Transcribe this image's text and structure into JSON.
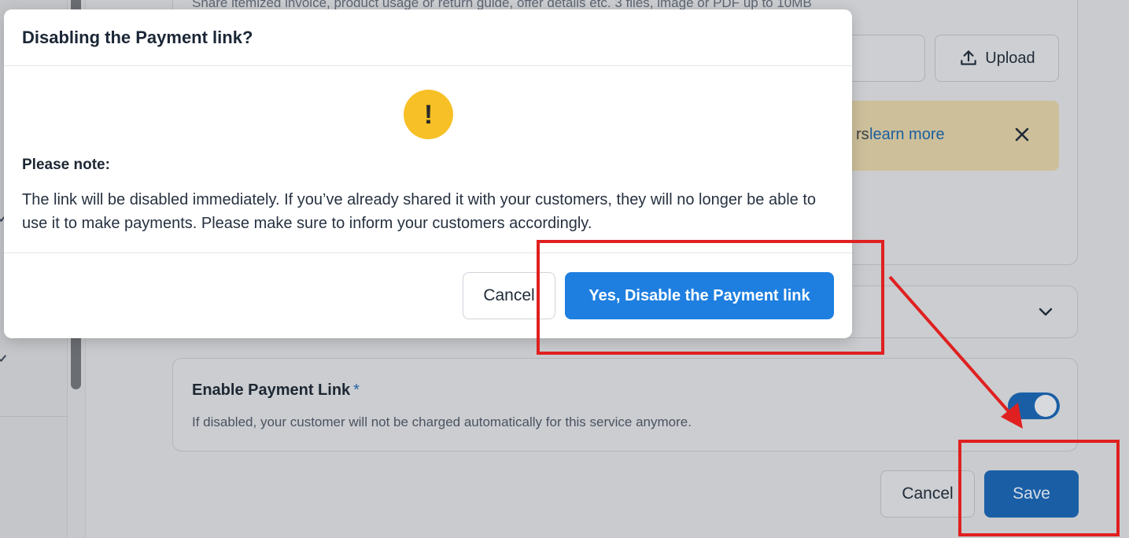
{
  "background": {
    "hint_text": "Share itemized invoice, product usage or return guide, offer details etc.  3 files, image or PDF up to 10MB",
    "upload_label": "Upload",
    "notice_partial": "rs",
    "notice_link": "learn more",
    "enable_title": "Enable Payment Link",
    "enable_required_marker": "*",
    "enable_description": "If disabled, your customer will not be charged automatically for this service anymore.",
    "toggle_on": true,
    "cancel_label": "Cancel",
    "save_label": "Save"
  },
  "modal": {
    "title": "Disabling the Payment link?",
    "warning_glyph": "!",
    "note_title": "Please note:",
    "note_body": "The link will be disabled immediately. If you’ve already shared it with your customers, they will no longer be able to use it to make payments. Please make sure to inform your customers accordingly.",
    "cancel_label": "Cancel",
    "confirm_label": "Yes, Disable the Payment link"
  },
  "colors": {
    "primary": "#1e7fe0",
    "warning": "#f6c026",
    "annotation": "#e02020"
  }
}
